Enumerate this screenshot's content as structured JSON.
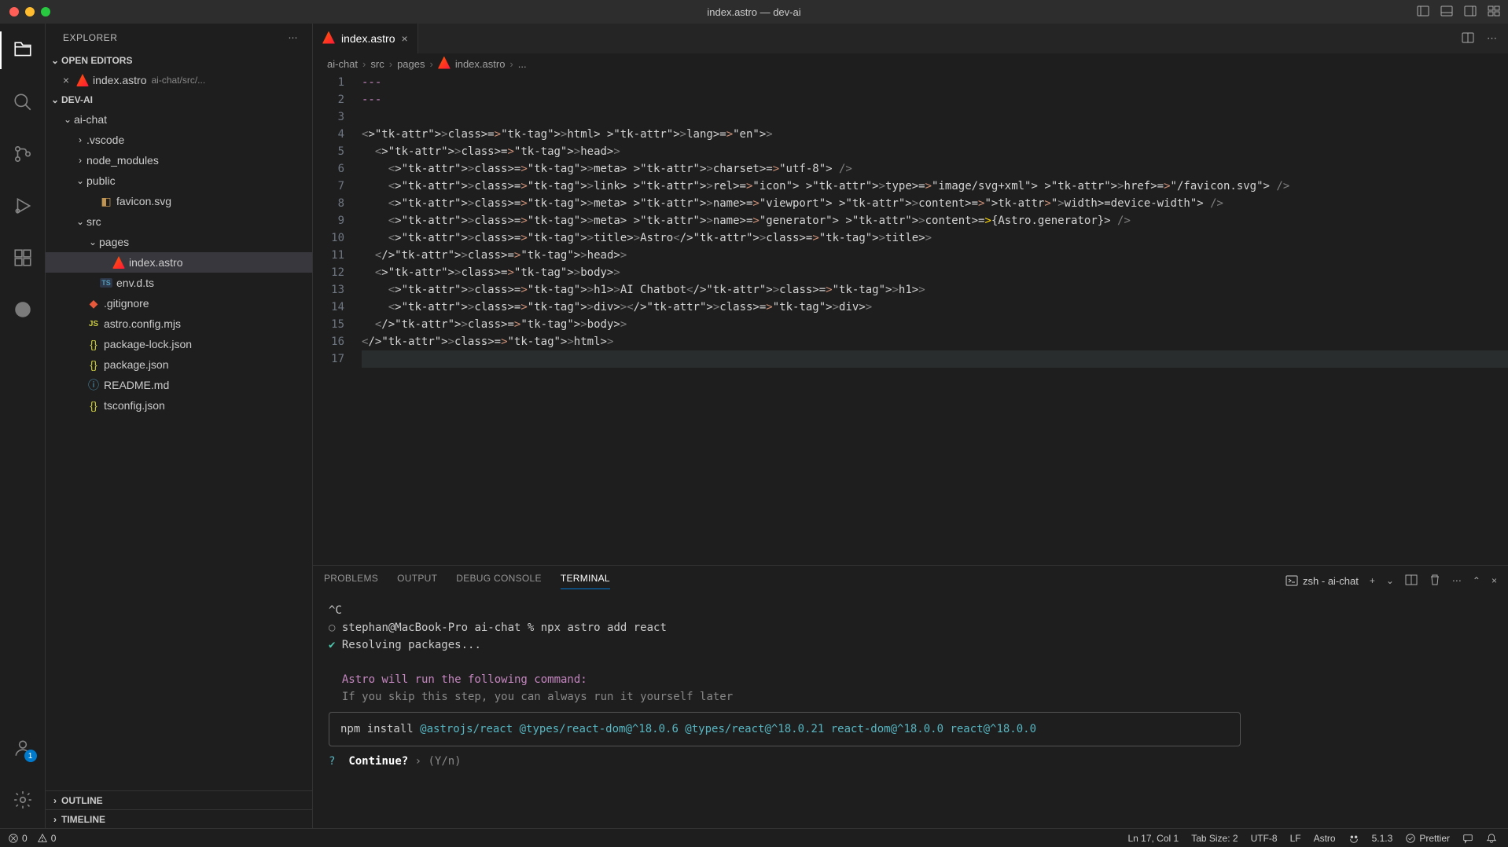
{
  "window": {
    "title": "index.astro — dev-ai"
  },
  "sidebar": {
    "title": "EXPLORER",
    "openEditors": {
      "label": "OPEN EDITORS",
      "items": [
        {
          "name": "index.astro",
          "path": "ai-chat/src/..."
        }
      ]
    },
    "workspace": {
      "label": "DEV-AI",
      "tree": [
        {
          "indent": 1,
          "type": "folder",
          "name": "ai-chat",
          "open": true
        },
        {
          "indent": 2,
          "type": "folder",
          "name": ".vscode",
          "open": false
        },
        {
          "indent": 2,
          "type": "folder",
          "name": "node_modules",
          "open": false
        },
        {
          "indent": 2,
          "type": "folder",
          "name": "public",
          "open": true
        },
        {
          "indent": 3,
          "type": "file",
          "name": "favicon.svg",
          "icon": "svg"
        },
        {
          "indent": 2,
          "type": "folder",
          "name": "src",
          "open": true
        },
        {
          "indent": 3,
          "type": "folder",
          "name": "pages",
          "open": true
        },
        {
          "indent": 4,
          "type": "file",
          "name": "index.astro",
          "icon": "astro",
          "selected": true
        },
        {
          "indent": 3,
          "type": "file",
          "name": "env.d.ts",
          "icon": "ts"
        },
        {
          "indent": 2,
          "type": "file",
          "name": ".gitignore",
          "icon": "git"
        },
        {
          "indent": 2,
          "type": "file",
          "name": "astro.config.mjs",
          "icon": "js"
        },
        {
          "indent": 2,
          "type": "file",
          "name": "package-lock.json",
          "icon": "json"
        },
        {
          "indent": 2,
          "type": "file",
          "name": "package.json",
          "icon": "json"
        },
        {
          "indent": 2,
          "type": "file",
          "name": "README.md",
          "icon": "info"
        },
        {
          "indent": 2,
          "type": "file",
          "name": "tsconfig.json",
          "icon": "json"
        }
      ]
    },
    "outline": "OUTLINE",
    "timeline": "TIMELINE"
  },
  "tabs": {
    "active": {
      "name": "index.astro"
    }
  },
  "breadcrumb": [
    "ai-chat",
    "src",
    "pages",
    "index.astro",
    "..."
  ],
  "code": {
    "lines": [
      "---",
      "---",
      "",
      "<html lang=\"en\">",
      "  <head>",
      "    <meta charset=\"utf-8\" />",
      "    <link rel=\"icon\" type=\"image/svg+xml\" href=\"/favicon.svg\" />",
      "    <meta name=\"viewport\" content=\"width=device-width\" />",
      "    <meta name=\"generator\" content={Astro.generator} />",
      "    <title>Astro</title>",
      "  </head>",
      "  <body>",
      "    <h1>AI Chatbot</h1>",
      "    <div></div>",
      "  </body>",
      "</html>",
      ""
    ]
  },
  "panel": {
    "tabs": [
      "PROBLEMS",
      "OUTPUT",
      "DEBUG CONSOLE",
      "TERMINAL"
    ],
    "activeTab": "TERMINAL",
    "terminalName": "zsh - ai-chat",
    "terminal": {
      "line1": "^C",
      "prompt": "stephan@MacBook-Pro ai-chat % ",
      "cmd": "npx astro add react",
      "resolving": "Resolving packages...",
      "msg1": "Astro will run the following command:",
      "msg2": "If you skip this step, you can always run it yourself later",
      "install": {
        "prefix": "npm install ",
        "pkgs": "@astrojs/react @types/react-dom@^18.0.6 @types/react@^18.0.21 react-dom@^18.0.0 react@^18.0.0"
      },
      "continueQ": "?",
      "continueLabel": "Continue?",
      "continueHint": " › (Y/n)"
    }
  },
  "statusbar": {
    "errors": "0",
    "warnings": "0",
    "position": "Ln 17, Col 1",
    "tabSize": "Tab Size: 2",
    "encoding": "UTF-8",
    "eol": "LF",
    "language": "Astro",
    "version": "5.1.3",
    "formatter": "Prettier"
  },
  "accounts": {
    "badge": "1"
  }
}
